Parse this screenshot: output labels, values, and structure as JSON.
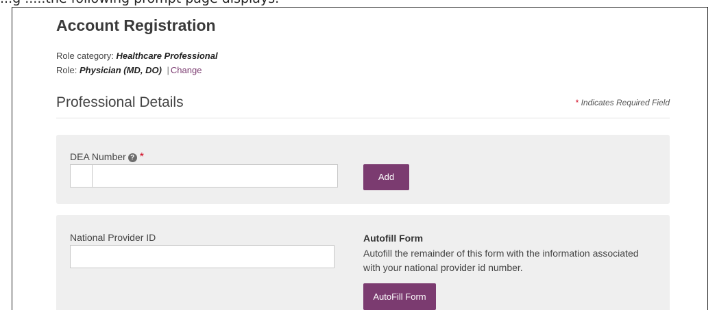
{
  "caption": "...g .....the following prompt page displays.",
  "page": {
    "title": "Account Registration",
    "role_category_label": "Role category:",
    "role_category_value": "Healthcare Professional",
    "role_label": "Role:",
    "role_value": "Physician (MD, DO)",
    "separator": "|",
    "change_link": "Change"
  },
  "section": {
    "heading": "Professional Details",
    "required_star": "*",
    "required_note": "Indicates Required Field"
  },
  "dea": {
    "label": "DEA Number",
    "help_icon": "question-circle-icon",
    "help_glyph": "?",
    "required_star": "*",
    "value": "",
    "add_button": "Add"
  },
  "npi": {
    "label": "National Provider ID",
    "value": "",
    "autofill_title": "Autofill Form",
    "autofill_description": "Autofill the remainder of this form with the information associated with your national provider id number.",
    "autofill_button": "AutoFill Form"
  },
  "colors": {
    "accent": "#7b3b70",
    "panel_bg": "#efefef",
    "required": "#d0021b"
  }
}
